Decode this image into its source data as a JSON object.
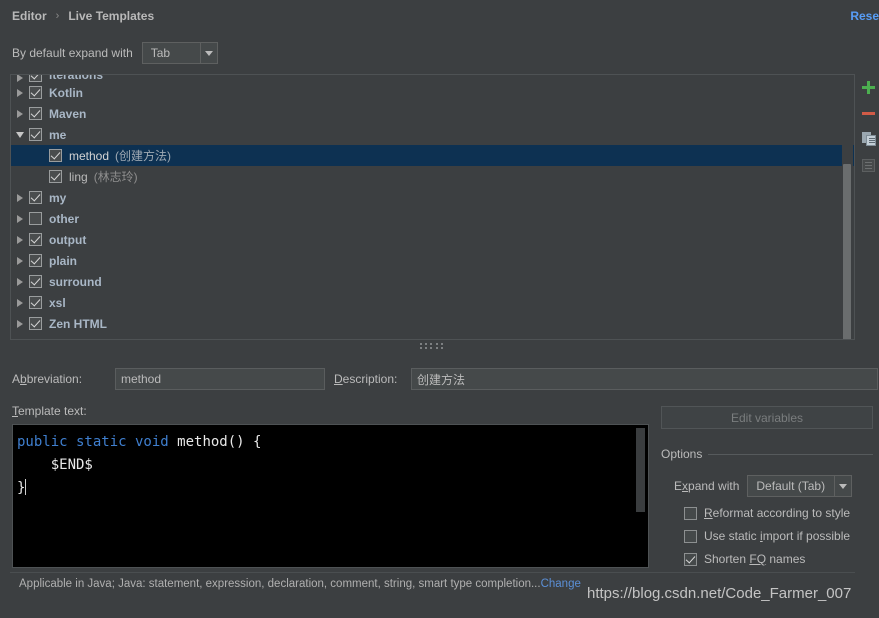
{
  "breadcrumb": {
    "root": "Editor",
    "separator": "›",
    "current": "Live Templates",
    "reset_label": "Reset"
  },
  "expand_default": {
    "label": "By default expand with",
    "value": "Tab"
  },
  "toolbar": {
    "add": "add-icon",
    "remove": "remove-icon",
    "duplicate": "duplicate-icon",
    "list": "list-icon"
  },
  "tree": {
    "rows": [
      {
        "name": "iterations",
        "desc": "",
        "checked": true,
        "expanded": false,
        "level": 0,
        "group": true,
        "selected": false,
        "clipped": true
      },
      {
        "name": "Kotlin",
        "desc": "",
        "checked": true,
        "expanded": false,
        "level": 0,
        "group": true,
        "selected": false,
        "clipped": false
      },
      {
        "name": "Maven",
        "desc": "",
        "checked": true,
        "expanded": false,
        "level": 0,
        "group": true,
        "selected": false,
        "clipped": false
      },
      {
        "name": "me",
        "desc": "",
        "checked": true,
        "expanded": true,
        "level": 0,
        "group": true,
        "selected": false,
        "clipped": false
      },
      {
        "name": "method",
        "desc": "(创建方法)",
        "checked": true,
        "expanded": false,
        "level": 1,
        "group": false,
        "selected": true,
        "clipped": false
      },
      {
        "name": "ling",
        "desc": "(林志玲)",
        "checked": true,
        "expanded": false,
        "level": 1,
        "group": false,
        "selected": false,
        "clipped": false
      },
      {
        "name": "my",
        "desc": "",
        "checked": true,
        "expanded": false,
        "level": 0,
        "group": true,
        "selected": false,
        "clipped": false
      },
      {
        "name": "other",
        "desc": "",
        "checked": false,
        "expanded": false,
        "level": 0,
        "group": true,
        "selected": false,
        "clipped": false
      },
      {
        "name": "output",
        "desc": "",
        "checked": true,
        "expanded": false,
        "level": 0,
        "group": true,
        "selected": false,
        "clipped": false
      },
      {
        "name": "plain",
        "desc": "",
        "checked": true,
        "expanded": false,
        "level": 0,
        "group": true,
        "selected": false,
        "clipped": false
      },
      {
        "name": "surround",
        "desc": "",
        "checked": true,
        "expanded": false,
        "level": 0,
        "group": true,
        "selected": false,
        "clipped": false
      },
      {
        "name": "xsl",
        "desc": "",
        "checked": true,
        "expanded": false,
        "level": 0,
        "group": true,
        "selected": false,
        "clipped": false
      },
      {
        "name": "Zen HTML",
        "desc": "",
        "checked": true,
        "expanded": false,
        "level": 0,
        "group": true,
        "selected": false,
        "clipped": false
      }
    ]
  },
  "form": {
    "abbreviation_label_pre": "A",
    "abbreviation_label_mnemonic": "b",
    "abbreviation_label_post": "breviation:",
    "abbreviation_value": "method",
    "description_label_mnemonic": "D",
    "description_label_post": "escription:",
    "description_value": "创建方法",
    "template_text_label_mnemonic": "T",
    "template_text_label_post": "emplate text:"
  },
  "editor": {
    "line1_keywords": "public static void ",
    "line1_rest": "method() {",
    "line2": "    $END$",
    "line3": "}"
  },
  "options": {
    "edit_variables_label": "Edit variables",
    "group_title": "Options",
    "expand_with_label_pre": "E",
    "expand_with_label_mnemonic": "x",
    "expand_with_label_post": "pand with",
    "expand_with_value": "Default (Tab)",
    "checkboxes": [
      {
        "mnemonic": "R",
        "pre": "",
        "post": "eformat according to style",
        "checked": false
      },
      {
        "mnemonic": "i",
        "pre": "Use static ",
        "post": "mport if possible",
        "checked": false
      },
      {
        "mnemonic": "FQ",
        "pre": "Shorten ",
        "post": " names",
        "checked": true
      }
    ]
  },
  "status": {
    "text": "Applicable in Java; Java: statement, expression, declaration, comment, string, smart type completion...",
    "change_link": "Change"
  },
  "watermark": "https://blog.csdn.net/Code_Farmer_007",
  "colors": {
    "background": "#3c3f41",
    "selection": "#0d3152",
    "link": "#589df6",
    "add_icon": "#4caf50",
    "remove_icon": "#d15b47",
    "editor_background": "#000000",
    "keyword": "#3f7fcf"
  }
}
